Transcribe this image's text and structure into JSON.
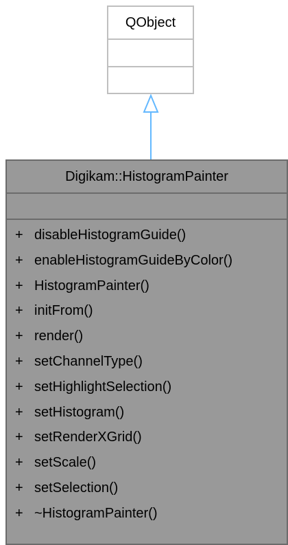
{
  "base_class": {
    "name": "QObject"
  },
  "derived_class": {
    "name": "Digikam::HistogramPainter",
    "methods": [
      {
        "visibility": "+",
        "name": "disableHistogramGuide()"
      },
      {
        "visibility": "+",
        "name": "enableHistogramGuideByColor()"
      },
      {
        "visibility": "+",
        "name": "HistogramPainter()"
      },
      {
        "visibility": "+",
        "name": "initFrom()"
      },
      {
        "visibility": "+",
        "name": "render()"
      },
      {
        "visibility": "+",
        "name": "setChannelType()"
      },
      {
        "visibility": "+",
        "name": "setHighlightSelection()"
      },
      {
        "visibility": "+",
        "name": "setHistogram()"
      },
      {
        "visibility": "+",
        "name": "setRenderXGrid()"
      },
      {
        "visibility": "+",
        "name": "setScale()"
      },
      {
        "visibility": "+",
        "name": "setSelection()"
      },
      {
        "visibility": "+",
        "name": "~HistogramPainter()"
      }
    ]
  },
  "colors": {
    "base_border": "#bfbfbf",
    "derived_fill": "#999999",
    "derived_border": "#6b6b6b",
    "arrow": "#63b8ff"
  }
}
